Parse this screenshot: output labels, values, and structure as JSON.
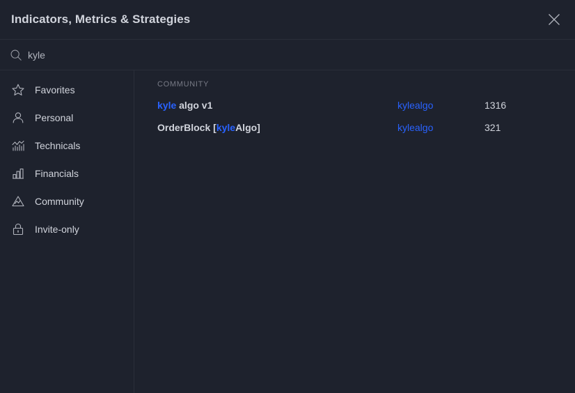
{
  "header": {
    "title": "Indicators, Metrics & Strategies",
    "close_label": "Close"
  },
  "search": {
    "value": "kyle",
    "placeholder": "Search"
  },
  "sidebar": {
    "items": [
      {
        "label": "Favorites",
        "icon": "star-icon"
      },
      {
        "label": "Personal",
        "icon": "person-icon"
      },
      {
        "label": "Technicals",
        "icon": "technicals-icon"
      },
      {
        "label": "Financials",
        "icon": "financials-icon"
      },
      {
        "label": "Community",
        "icon": "community-icon"
      },
      {
        "label": "Invite-only",
        "icon": "lock-icon"
      }
    ]
  },
  "results": {
    "group_title": "COMMUNITY",
    "rows": [
      {
        "name_prefix": "",
        "name_highlight": "kyle",
        "name_suffix": " algo v1",
        "author": "kylealgo",
        "count": "1316"
      },
      {
        "name_prefix": "OrderBlock [",
        "name_highlight": "kyle",
        "name_suffix": "Algo]",
        "author": "kylealgo",
        "count": "321"
      }
    ]
  },
  "colors": {
    "background": "#1e222d",
    "divider": "#2a2e39",
    "text": "#d1d4dc",
    "muted": "#787b86",
    "accent": "#2962ff"
  }
}
